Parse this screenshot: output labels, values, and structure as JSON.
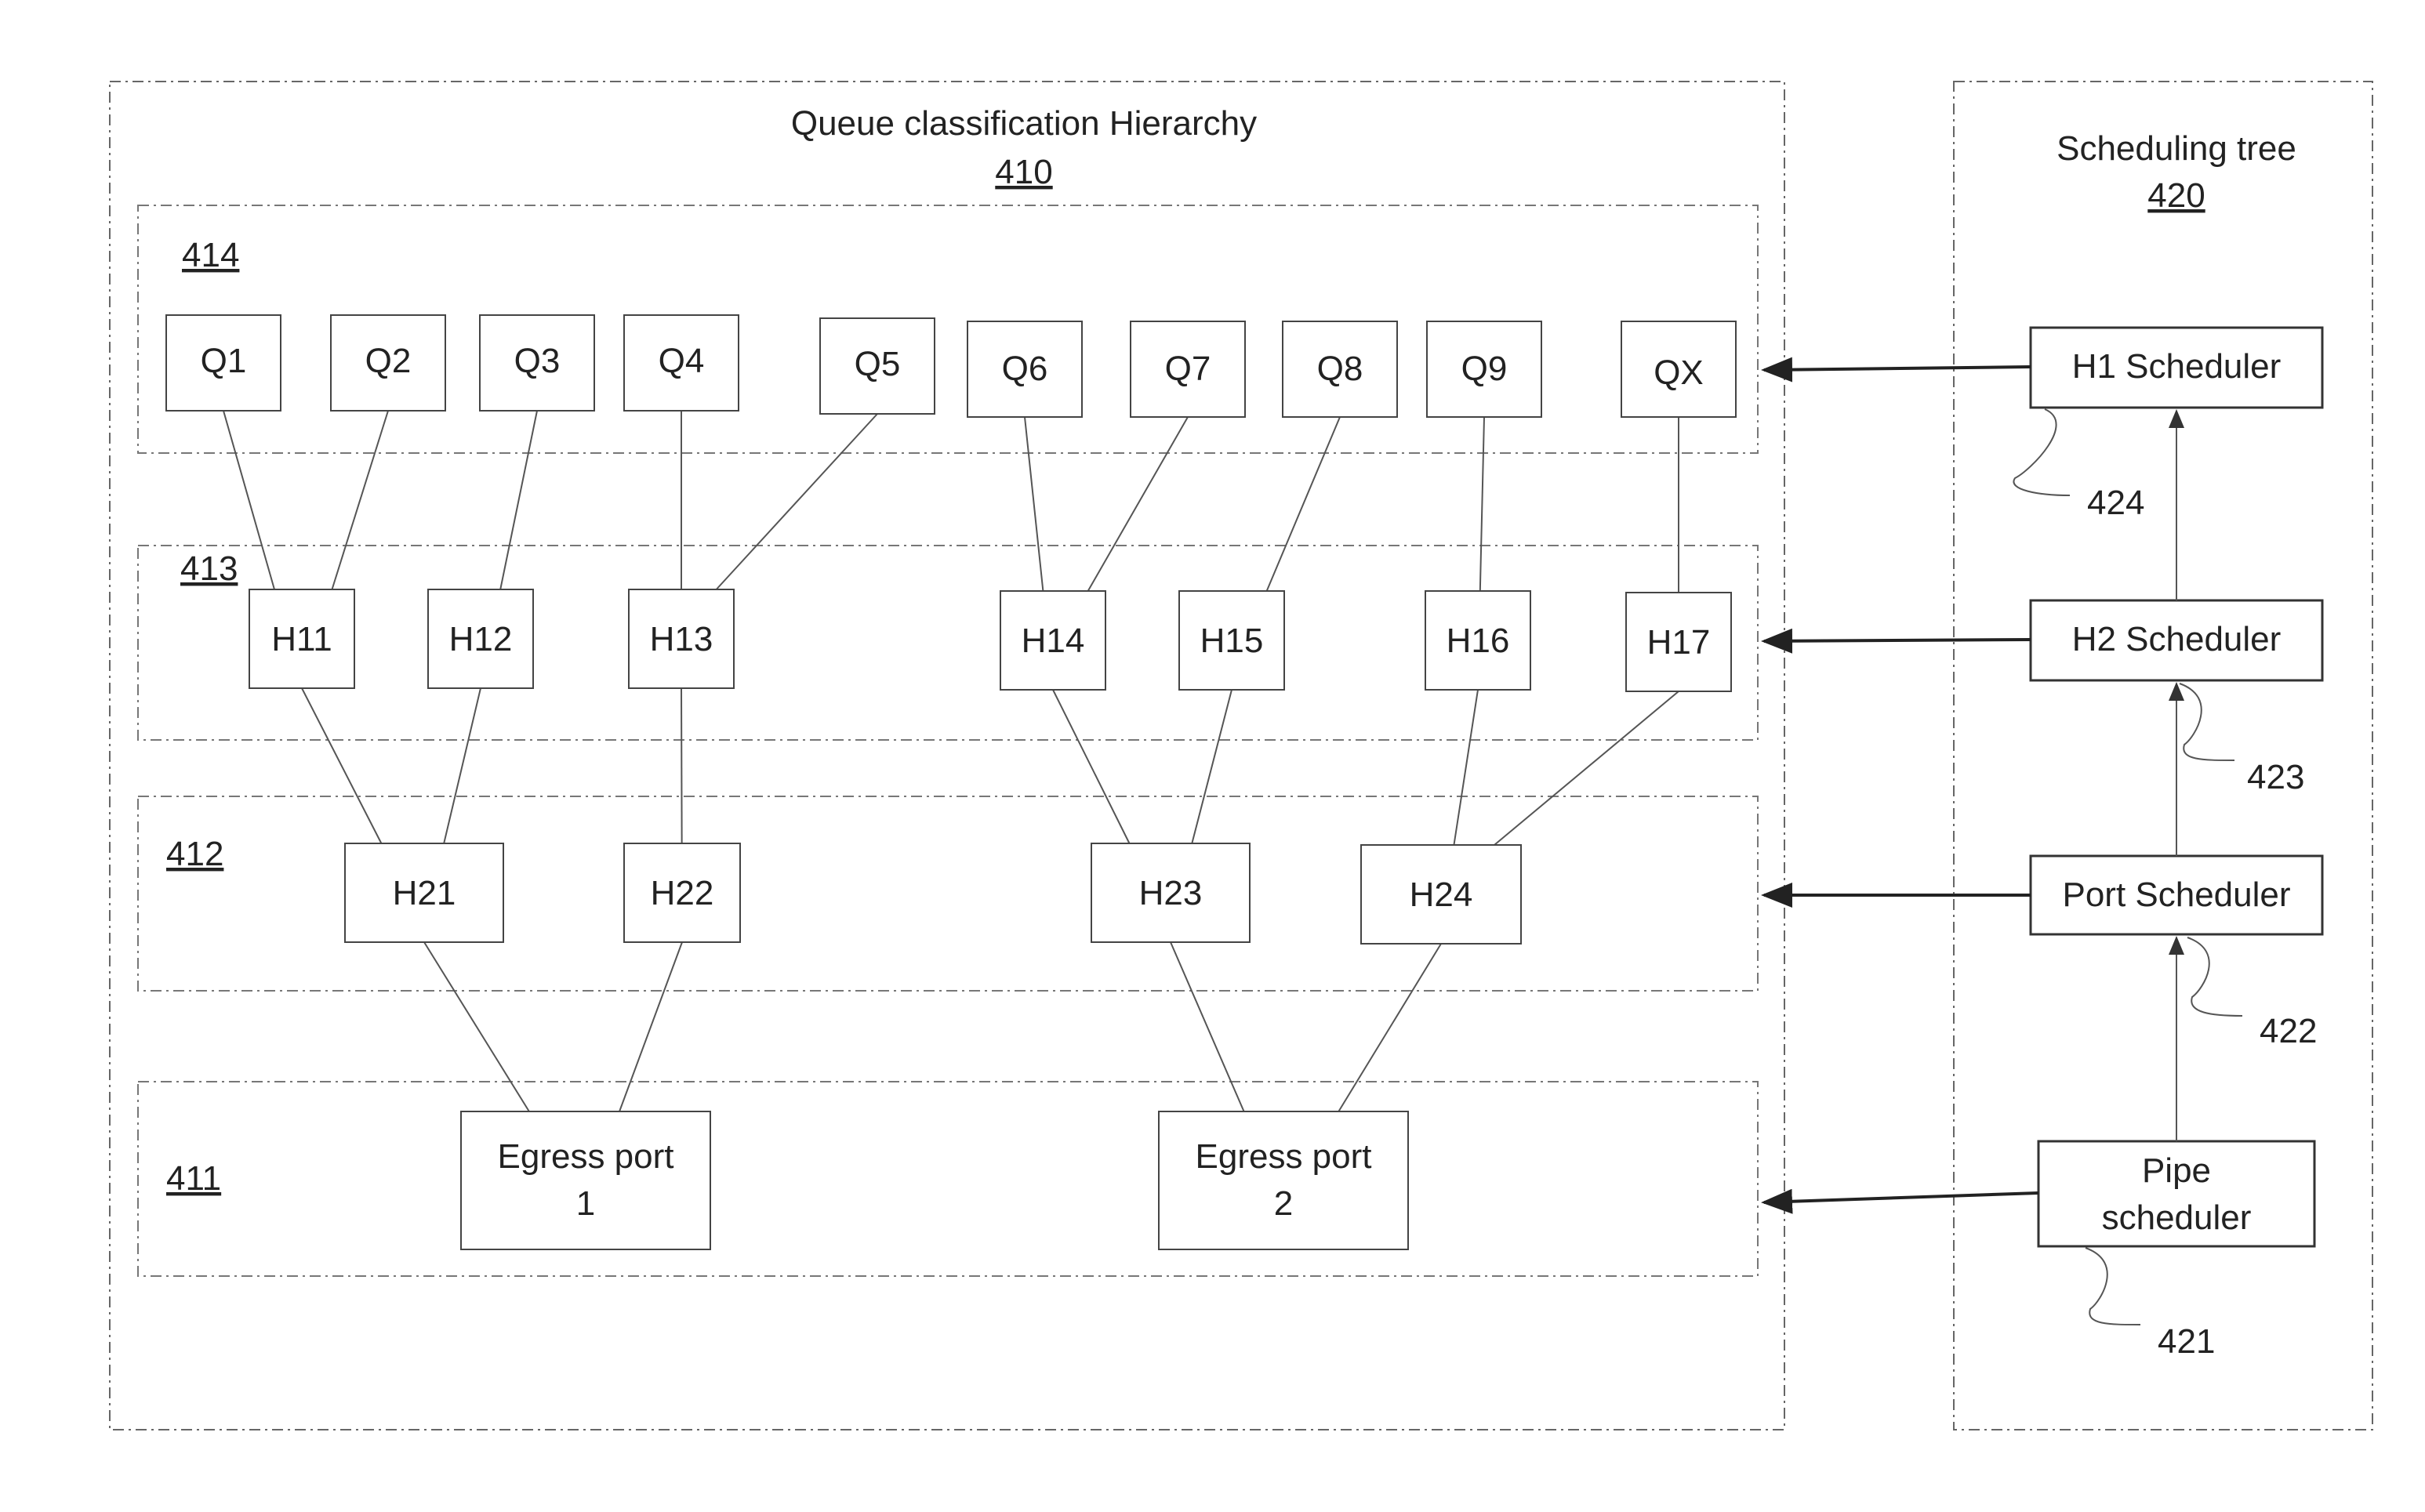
{
  "hierarchy": {
    "title": "Queue classification Hierarchy",
    "ref": "410",
    "levels": [
      {
        "ref": "414",
        "name": "queue-level"
      },
      {
        "ref": "413",
        "name": "h1-level"
      },
      {
        "ref": "412",
        "name": "h2-level"
      },
      {
        "ref": "411",
        "name": "port-level"
      }
    ],
    "queues": [
      "Q1",
      "Q2",
      "Q3",
      "Q4",
      "Q5",
      "Q6",
      "Q7",
      "Q8",
      "Q9",
      "QX"
    ],
    "h1_nodes": [
      "H11",
      "H12",
      "H13",
      "H14",
      "H15",
      "H16",
      "H17"
    ],
    "h2_nodes": [
      "H21",
      "H22",
      "H23",
      "H24"
    ],
    "ports": [
      {
        "line1": "Egress port",
        "line2": "1"
      },
      {
        "line1": "Egress port",
        "line2": "2"
      }
    ],
    "edges": [
      [
        "Q1",
        "H11"
      ],
      [
        "Q2",
        "H11"
      ],
      [
        "Q3",
        "H12"
      ],
      [
        "Q4",
        "H13"
      ],
      [
        "Q5",
        "H13"
      ],
      [
        "Q6",
        "H14"
      ],
      [
        "Q7",
        "H14"
      ],
      [
        "Q8",
        "H15"
      ],
      [
        "Q9",
        "H16"
      ],
      [
        "QX",
        "H17"
      ],
      [
        "H11",
        "H21"
      ],
      [
        "H12",
        "H21"
      ],
      [
        "H13",
        "H22"
      ],
      [
        "H14",
        "H23"
      ],
      [
        "H15",
        "H23"
      ],
      [
        "H16",
        "H24"
      ],
      [
        "H17",
        "H24"
      ],
      [
        "H21",
        "P1"
      ],
      [
        "H22",
        "P1"
      ],
      [
        "H23",
        "P2"
      ],
      [
        "H24",
        "P2"
      ]
    ]
  },
  "scheduling_tree": {
    "title": "Scheduling tree",
    "ref": "420",
    "schedulers": [
      {
        "label": "H1 Scheduler",
        "ref": "424",
        "targets": "414"
      },
      {
        "label": "H2 Scheduler",
        "ref": "423",
        "targets": "413"
      },
      {
        "label": "Port Scheduler",
        "ref": "422",
        "targets": "412"
      },
      {
        "line1": "Pipe",
        "line2": "scheduler",
        "ref": "421",
        "targets": "411"
      }
    ]
  }
}
